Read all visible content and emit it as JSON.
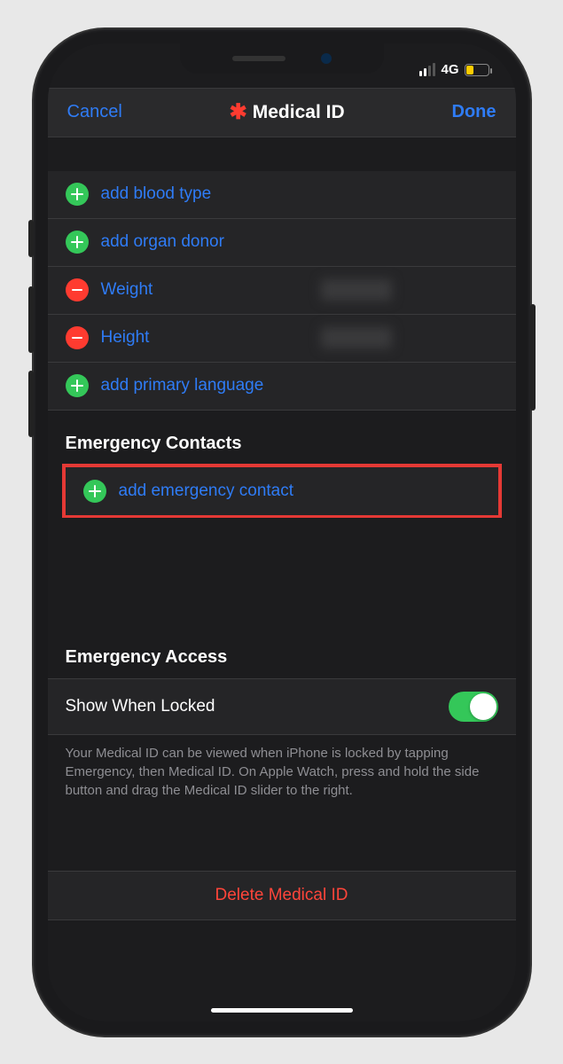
{
  "status": {
    "network": "4G"
  },
  "nav": {
    "cancel": "Cancel",
    "title": "Medical ID",
    "done": "Done"
  },
  "rows": {
    "bloodType": "add blood type",
    "organDonor": "add organ donor",
    "weight": "Weight",
    "height": "Height",
    "primaryLang": "add primary language"
  },
  "emergencyContacts": {
    "header": "Emergency Contacts",
    "add": "add emergency contact"
  },
  "emergencyAccess": {
    "header": "Emergency Access",
    "toggleLabel": "Show When Locked",
    "footer": "Your Medical ID can be viewed when iPhone is locked by tapping Emergency, then Medical ID. On Apple Watch, press and hold the side button and drag the Medical ID slider to the right."
  },
  "delete": "Delete Medical ID"
}
